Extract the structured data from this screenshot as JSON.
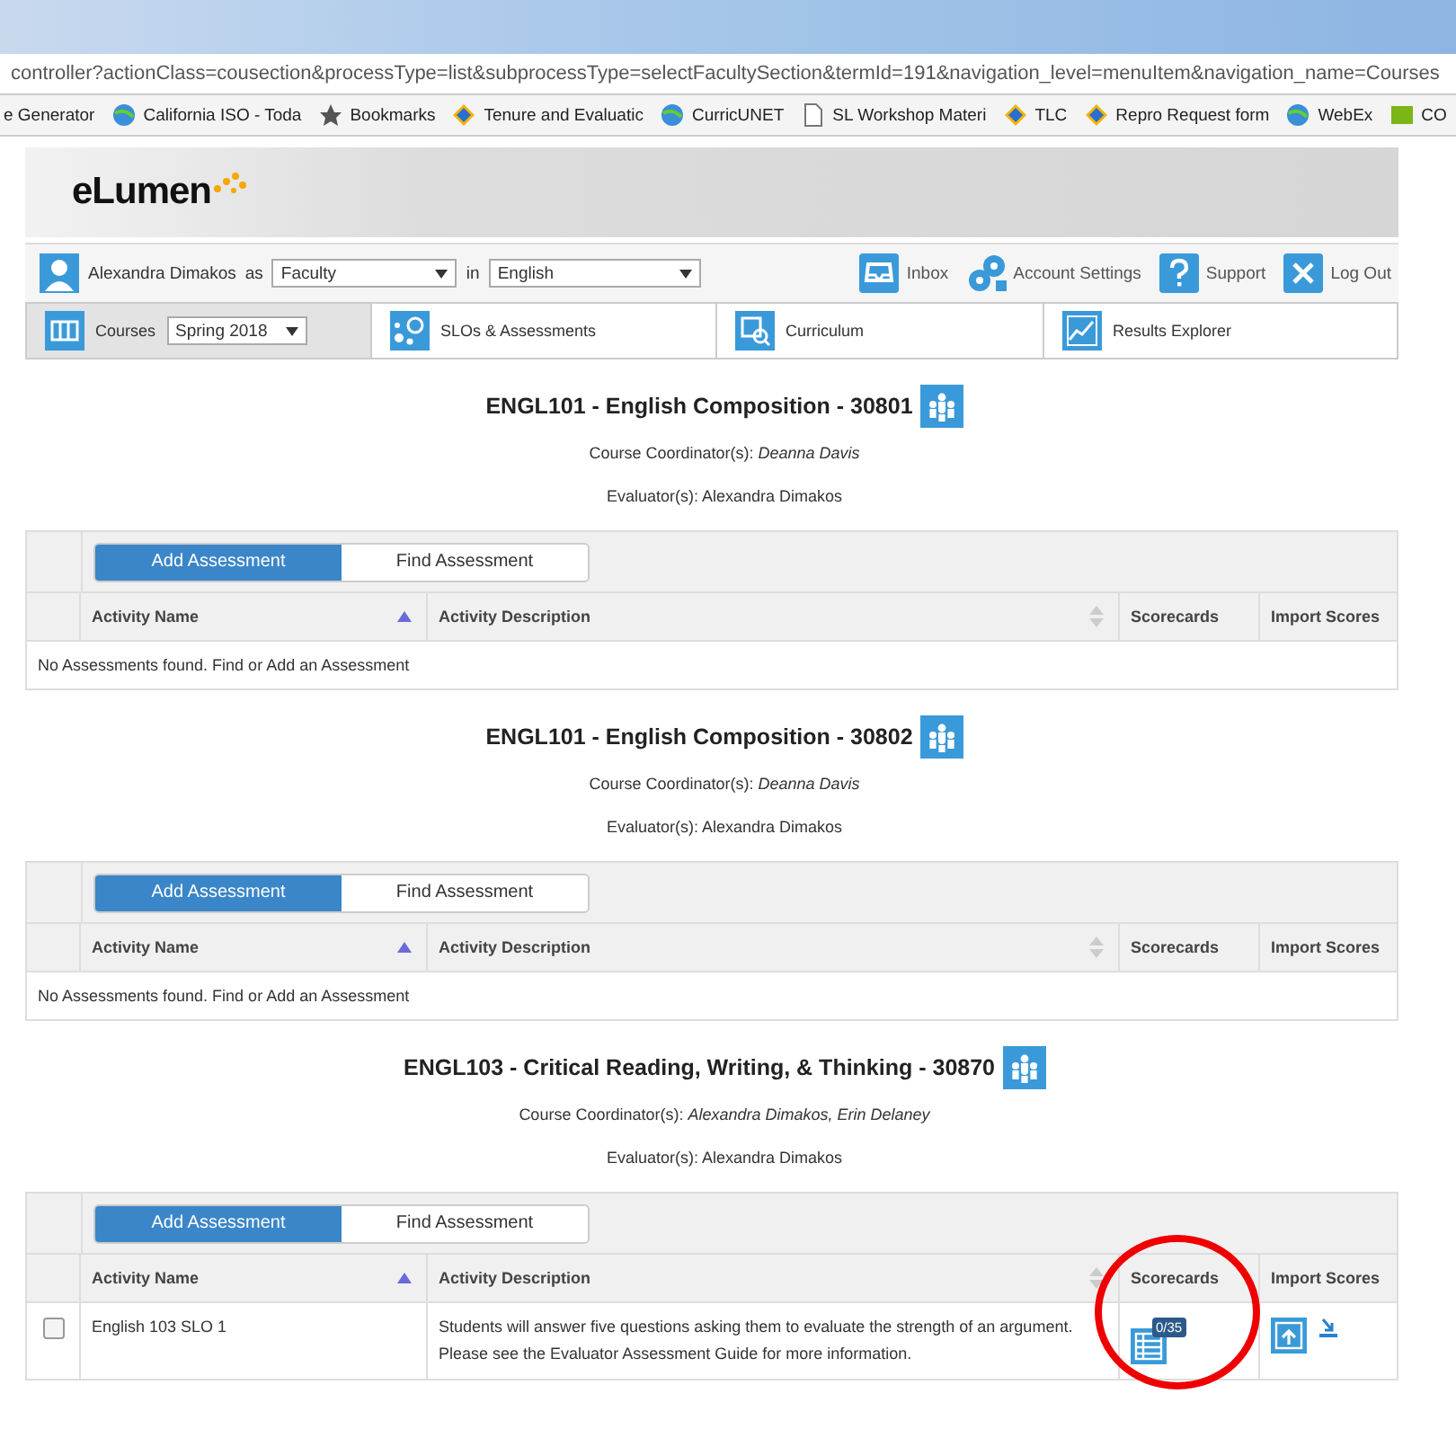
{
  "browser": {
    "url": "controller?actionClass=cousection&processType=list&subprocessType=selectFacultySection&termId=191&navigation_level=menuItem&navigation_name=Courses",
    "bookmarks": [
      {
        "label": "e Generator",
        "kind": "none"
      },
      {
        "label": "California ISO - Toda",
        "kind": "globe"
      },
      {
        "label": "Bookmarks",
        "kind": "star"
      },
      {
        "label": "Tenure and Evaluatic",
        "kind": "diamond"
      },
      {
        "label": "CurricUNET",
        "kind": "globe"
      },
      {
        "label": "SL Workshop Materi",
        "kind": "page"
      },
      {
        "label": "TLC",
        "kind": "diamond"
      },
      {
        "label": "Repro Request form",
        "kind": "diamond"
      },
      {
        "label": "WebEx",
        "kind": "globe"
      },
      {
        "label": "CO",
        "kind": "square"
      }
    ]
  },
  "logo": "eLumen",
  "user_bar": {
    "user": "Alexandra Dimakos",
    "as_label": "as",
    "role": "Faculty",
    "in_label": "in",
    "department": "English",
    "actions": [
      {
        "label": "Inbox",
        "kind": "inbox"
      },
      {
        "label": "Account Settings",
        "kind": "gears"
      },
      {
        "label": "Support",
        "kind": "help"
      },
      {
        "label": "Log Out",
        "kind": "close"
      }
    ]
  },
  "nav_tabs": [
    {
      "label": "Courses",
      "kind": "courses",
      "selected": true,
      "term": "Spring 2018"
    },
    {
      "label": "SLOs & Assessments",
      "kind": "slos",
      "selected": false
    },
    {
      "label": "Curriculum",
      "kind": "curriculum",
      "selected": false
    },
    {
      "label": "Results Explorer",
      "kind": "results",
      "selected": false
    }
  ],
  "sections": [
    {
      "title": "ENGL101 - English Composition - 30801",
      "coordinators": "Course Coordinator(s): *Deanna Davis*",
      "evaluators": "Evaluator(s): Alexandra Dimakos",
      "buttons": [
        "Add Assessment",
        "Find Assessment"
      ],
      "columns": [
        "Activity Name",
        "Activity Description",
        "Scorecards",
        "Import Scores"
      ],
      "empty_message": "No Assessments found. Find or Add an Assessment"
    },
    {
      "title": "ENGL101 - English Composition - 30802",
      "coordinators": "Course Coordinator(s): *Deanna Davis*",
      "evaluators": "Evaluator(s): Alexandra Dimakos",
      "buttons": [
        "Add Assessment",
        "Find Assessment"
      ],
      "columns": [
        "Activity Name",
        "Activity Description",
        "Scorecards",
        "Import Scores"
      ],
      "empty_message": "No Assessments found. Find or Add an Assessment"
    },
    {
      "title": "ENGL103 - Critical Reading, Writing, & Thinking - 30870",
      "coordinators": "Course Coordinator(s): *Alexandra Dimakos, Erin Delaney*",
      "evaluators": "Evaluator(s): Alexandra Dimakos",
      "buttons": [
        "Add Assessment",
        "Find Assessment"
      ],
      "columns": [
        "Activity Name",
        "Activity Description",
        "Scorecards",
        "Import Scores"
      ],
      "rows": [
        {
          "checked": false,
          "name": "English 103 SLO 1",
          "description": "Students will answer five questions asking them to evaluate the strength of an argument. Please see the Evaluator Assessment Guide for more information.",
          "scorecard_count": "0/35",
          "highlighted": true
        }
      ]
    }
  ]
}
